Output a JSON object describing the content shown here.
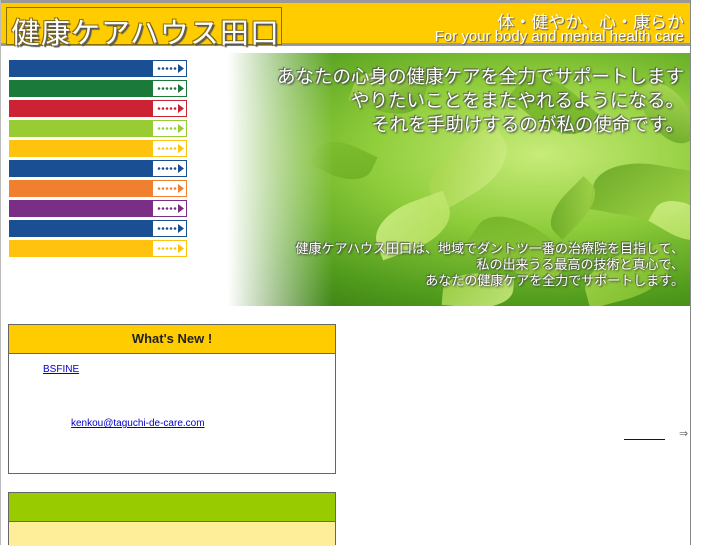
{
  "header": {
    "site_title": "健康ケアハウス田口",
    "tagline_jp": "体・健やか、心・康らか",
    "tagline_en": "For your body and mental health care",
    "background_color": "#ffcc00"
  },
  "nav": {
    "items": [
      {
        "color": "#1a4f94"
      },
      {
        "color": "#1b7a3a"
      },
      {
        "color": "#cc2233"
      },
      {
        "color": "#99cc33"
      },
      {
        "color": "#ffc20e"
      },
      {
        "color": "#1a4f94"
      },
      {
        "color": "#f08030"
      },
      {
        "color": "#7a2e86"
      },
      {
        "color": "#1a4f94"
      },
      {
        "color": "#ffc20e"
      }
    ],
    "arrow_icon": "dotted-arrow-icon"
  },
  "hero": {
    "headline_lines": [
      "あなたの心身の健康ケアを全力でサポートします",
      "やりたいことをまたやれるようになる。",
      "それを手助けするのが私の使命です。"
    ],
    "body_lines": [
      "健康ケアハウス田口は、地域でダントツ一番の治療院を目指して、",
      "私の出来うる最高の技術と真心で、",
      "あなたの健康ケアを全力でサポートします。"
    ]
  },
  "news": {
    "heading": "What's New !",
    "link1": "BSFINE",
    "link2": "kenkou@taguchi-de-care.com"
  },
  "side": {
    "arrow": "⇒"
  }
}
